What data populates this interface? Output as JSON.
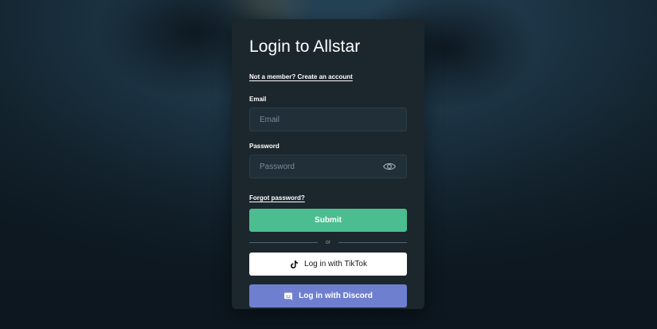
{
  "login": {
    "title": "Login to Allstar",
    "signup_link": "Not a member? Create an account",
    "email_label": "Email",
    "email_placeholder": "Email",
    "email_value": "",
    "password_label": "Password",
    "password_placeholder": "Password",
    "password_value": "",
    "forgot_link": "Forgot password?",
    "submit_label": "Submit",
    "divider_text": "or",
    "tiktok_label": "Log in with TikTok",
    "discord_label": "Log in with Discord"
  },
  "icons": {
    "password_toggle": "eye-icon",
    "tiktok": "tiktok-icon",
    "discord": "discord-icon"
  },
  "colors": {
    "card": "#1c262d",
    "input": "#212f39",
    "submit": "#4bbd90",
    "tiktok_bg": "#ffffff",
    "discord": "#6f7fcf"
  }
}
